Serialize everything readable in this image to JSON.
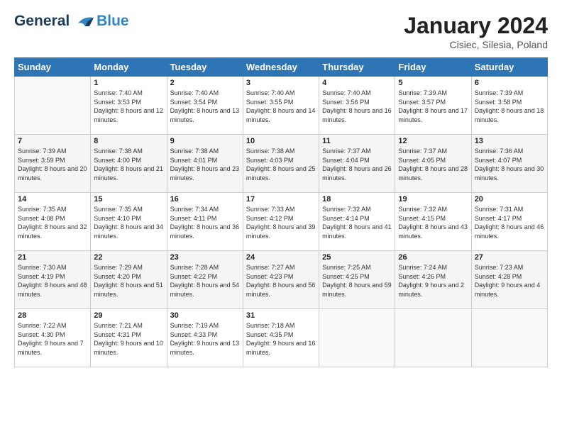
{
  "header": {
    "logo_line1": "General",
    "logo_line2": "Blue",
    "month": "January 2024",
    "location": "Cisiec, Silesia, Poland"
  },
  "weekdays": [
    "Sunday",
    "Monday",
    "Tuesday",
    "Wednesday",
    "Thursday",
    "Friday",
    "Saturday"
  ],
  "weeks": [
    [
      {
        "day": "",
        "sunrise": "",
        "sunset": "",
        "daylight": ""
      },
      {
        "day": "1",
        "sunrise": "Sunrise: 7:40 AM",
        "sunset": "Sunset: 3:53 PM",
        "daylight": "Daylight: 8 hours and 12 minutes."
      },
      {
        "day": "2",
        "sunrise": "Sunrise: 7:40 AM",
        "sunset": "Sunset: 3:54 PM",
        "daylight": "Daylight: 8 hours and 13 minutes."
      },
      {
        "day": "3",
        "sunrise": "Sunrise: 7:40 AM",
        "sunset": "Sunset: 3:55 PM",
        "daylight": "Daylight: 8 hours and 14 minutes."
      },
      {
        "day": "4",
        "sunrise": "Sunrise: 7:40 AM",
        "sunset": "Sunset: 3:56 PM",
        "daylight": "Daylight: 8 hours and 16 minutes."
      },
      {
        "day": "5",
        "sunrise": "Sunrise: 7:39 AM",
        "sunset": "Sunset: 3:57 PM",
        "daylight": "Daylight: 8 hours and 17 minutes."
      },
      {
        "day": "6",
        "sunrise": "Sunrise: 7:39 AM",
        "sunset": "Sunset: 3:58 PM",
        "daylight": "Daylight: 8 hours and 18 minutes."
      }
    ],
    [
      {
        "day": "7",
        "sunrise": "Sunrise: 7:39 AM",
        "sunset": "Sunset: 3:59 PM",
        "daylight": "Daylight: 8 hours and 20 minutes."
      },
      {
        "day": "8",
        "sunrise": "Sunrise: 7:38 AM",
        "sunset": "Sunset: 4:00 PM",
        "daylight": "Daylight: 8 hours and 21 minutes."
      },
      {
        "day": "9",
        "sunrise": "Sunrise: 7:38 AM",
        "sunset": "Sunset: 4:01 PM",
        "daylight": "Daylight: 8 hours and 23 minutes."
      },
      {
        "day": "10",
        "sunrise": "Sunrise: 7:38 AM",
        "sunset": "Sunset: 4:03 PM",
        "daylight": "Daylight: 8 hours and 25 minutes."
      },
      {
        "day": "11",
        "sunrise": "Sunrise: 7:37 AM",
        "sunset": "Sunset: 4:04 PM",
        "daylight": "Daylight: 8 hours and 26 minutes."
      },
      {
        "day": "12",
        "sunrise": "Sunrise: 7:37 AM",
        "sunset": "Sunset: 4:05 PM",
        "daylight": "Daylight: 8 hours and 28 minutes."
      },
      {
        "day": "13",
        "sunrise": "Sunrise: 7:36 AM",
        "sunset": "Sunset: 4:07 PM",
        "daylight": "Daylight: 8 hours and 30 minutes."
      }
    ],
    [
      {
        "day": "14",
        "sunrise": "Sunrise: 7:35 AM",
        "sunset": "Sunset: 4:08 PM",
        "daylight": "Daylight: 8 hours and 32 minutes."
      },
      {
        "day": "15",
        "sunrise": "Sunrise: 7:35 AM",
        "sunset": "Sunset: 4:10 PM",
        "daylight": "Daylight: 8 hours and 34 minutes."
      },
      {
        "day": "16",
        "sunrise": "Sunrise: 7:34 AM",
        "sunset": "Sunset: 4:11 PM",
        "daylight": "Daylight: 8 hours and 36 minutes."
      },
      {
        "day": "17",
        "sunrise": "Sunrise: 7:33 AM",
        "sunset": "Sunset: 4:12 PM",
        "daylight": "Daylight: 8 hours and 39 minutes."
      },
      {
        "day": "18",
        "sunrise": "Sunrise: 7:32 AM",
        "sunset": "Sunset: 4:14 PM",
        "daylight": "Daylight: 8 hours and 41 minutes."
      },
      {
        "day": "19",
        "sunrise": "Sunrise: 7:32 AM",
        "sunset": "Sunset: 4:15 PM",
        "daylight": "Daylight: 8 hours and 43 minutes."
      },
      {
        "day": "20",
        "sunrise": "Sunrise: 7:31 AM",
        "sunset": "Sunset: 4:17 PM",
        "daylight": "Daylight: 8 hours and 46 minutes."
      }
    ],
    [
      {
        "day": "21",
        "sunrise": "Sunrise: 7:30 AM",
        "sunset": "Sunset: 4:19 PM",
        "daylight": "Daylight: 8 hours and 48 minutes."
      },
      {
        "day": "22",
        "sunrise": "Sunrise: 7:29 AM",
        "sunset": "Sunset: 4:20 PM",
        "daylight": "Daylight: 8 hours and 51 minutes."
      },
      {
        "day": "23",
        "sunrise": "Sunrise: 7:28 AM",
        "sunset": "Sunset: 4:22 PM",
        "daylight": "Daylight: 8 hours and 54 minutes."
      },
      {
        "day": "24",
        "sunrise": "Sunrise: 7:27 AM",
        "sunset": "Sunset: 4:23 PM",
        "daylight": "Daylight: 8 hours and 56 minutes."
      },
      {
        "day": "25",
        "sunrise": "Sunrise: 7:25 AM",
        "sunset": "Sunset: 4:25 PM",
        "daylight": "Daylight: 8 hours and 59 minutes."
      },
      {
        "day": "26",
        "sunrise": "Sunrise: 7:24 AM",
        "sunset": "Sunset: 4:26 PM",
        "daylight": "Daylight: 9 hours and 2 minutes."
      },
      {
        "day": "27",
        "sunrise": "Sunrise: 7:23 AM",
        "sunset": "Sunset: 4:28 PM",
        "daylight": "Daylight: 9 hours and 4 minutes."
      }
    ],
    [
      {
        "day": "28",
        "sunrise": "Sunrise: 7:22 AM",
        "sunset": "Sunset: 4:30 PM",
        "daylight": "Daylight: 9 hours and 7 minutes."
      },
      {
        "day": "29",
        "sunrise": "Sunrise: 7:21 AM",
        "sunset": "Sunset: 4:31 PM",
        "daylight": "Daylight: 9 hours and 10 minutes."
      },
      {
        "day": "30",
        "sunrise": "Sunrise: 7:19 AM",
        "sunset": "Sunset: 4:33 PM",
        "daylight": "Daylight: 9 hours and 13 minutes."
      },
      {
        "day": "31",
        "sunrise": "Sunrise: 7:18 AM",
        "sunset": "Sunset: 4:35 PM",
        "daylight": "Daylight: 9 hours and 16 minutes."
      },
      {
        "day": "",
        "sunrise": "",
        "sunset": "",
        "daylight": ""
      },
      {
        "day": "",
        "sunrise": "",
        "sunset": "",
        "daylight": ""
      },
      {
        "day": "",
        "sunrise": "",
        "sunset": "",
        "daylight": ""
      }
    ]
  ]
}
